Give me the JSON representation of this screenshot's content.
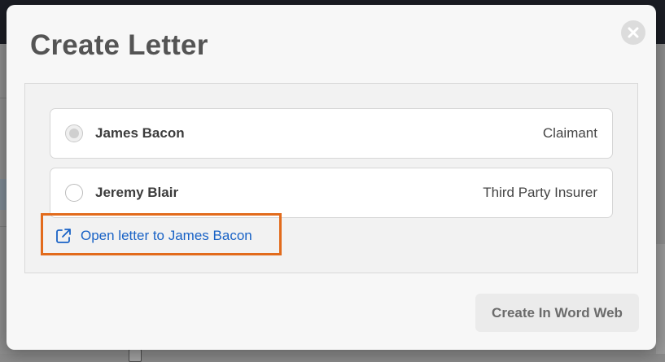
{
  "dialog": {
    "title": "Create Letter",
    "close_icon": "close-icon"
  },
  "recipients": [
    {
      "name": "James Bacon",
      "role": "Claimant",
      "selected": true
    },
    {
      "name": "Jeremy Blair",
      "role": "Third Party Insurer",
      "selected": false
    }
  ],
  "open_letter_link": {
    "label": "Open letter to James Bacon",
    "icon": "external-link-icon"
  },
  "actions": {
    "create_label": "Create In Word Web"
  },
  "colors": {
    "link": "#1a63c6",
    "highlight": "#e26b1c",
    "title": "#545454"
  }
}
